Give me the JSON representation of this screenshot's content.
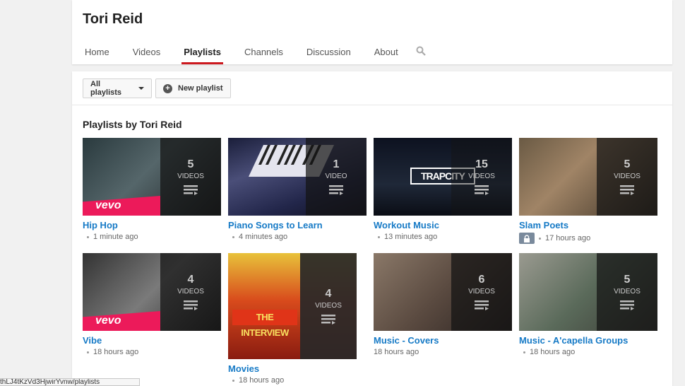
{
  "channel": {
    "title": "Tori Reid"
  },
  "tabs": [
    {
      "label": "Home"
    },
    {
      "label": "Videos"
    },
    {
      "label": "Playlists"
    },
    {
      "label": "Channels"
    },
    {
      "label": "Discussion"
    },
    {
      "label": "About"
    }
  ],
  "toolbar": {
    "all_playlists": "All playlists",
    "new_playlist": "New playlist"
  },
  "section": {
    "title": "Playlists by Tori Reid"
  },
  "playlists": [
    {
      "title": "Hip Hop",
      "count": "5",
      "unit": "VIDEOS",
      "meta": "1 minute ago",
      "brand": "vevo"
    },
    {
      "title": "Piano Songs to Learn",
      "count": "1",
      "unit": "VIDEO",
      "meta": "4 minutes ago"
    },
    {
      "title": "Workout Music",
      "count": "15",
      "unit": "VIDEOS",
      "meta": "13 minutes ago",
      "art_text": "TRAPCITY"
    },
    {
      "title": "Slam Poets",
      "count": "5",
      "unit": "VIDEOS",
      "meta": "17 hours ago"
    },
    {
      "title": "Vibe",
      "count": "4",
      "unit": "VIDEOS",
      "meta": "18 hours ago",
      "brand": "vevo"
    },
    {
      "title": "Movies",
      "count": "4",
      "unit": "VIDEOS",
      "meta": "18 hours ago",
      "art_text": "THE INTERVIEW"
    },
    {
      "title": "Music - Covers",
      "count": "6",
      "unit": "VIDEOS",
      "meta": "18 hours ago"
    },
    {
      "title": "Music - A'capella Groups",
      "count": "5",
      "unit": "VIDEOS",
      "meta": "18 hours ago"
    }
  ],
  "status_url": "thLJ4tKzVd3HjwirYvnw/playlists",
  "colors": {
    "accent": "#cc181e",
    "link": "#167ac6",
    "vevo": "#ec1a5a"
  }
}
